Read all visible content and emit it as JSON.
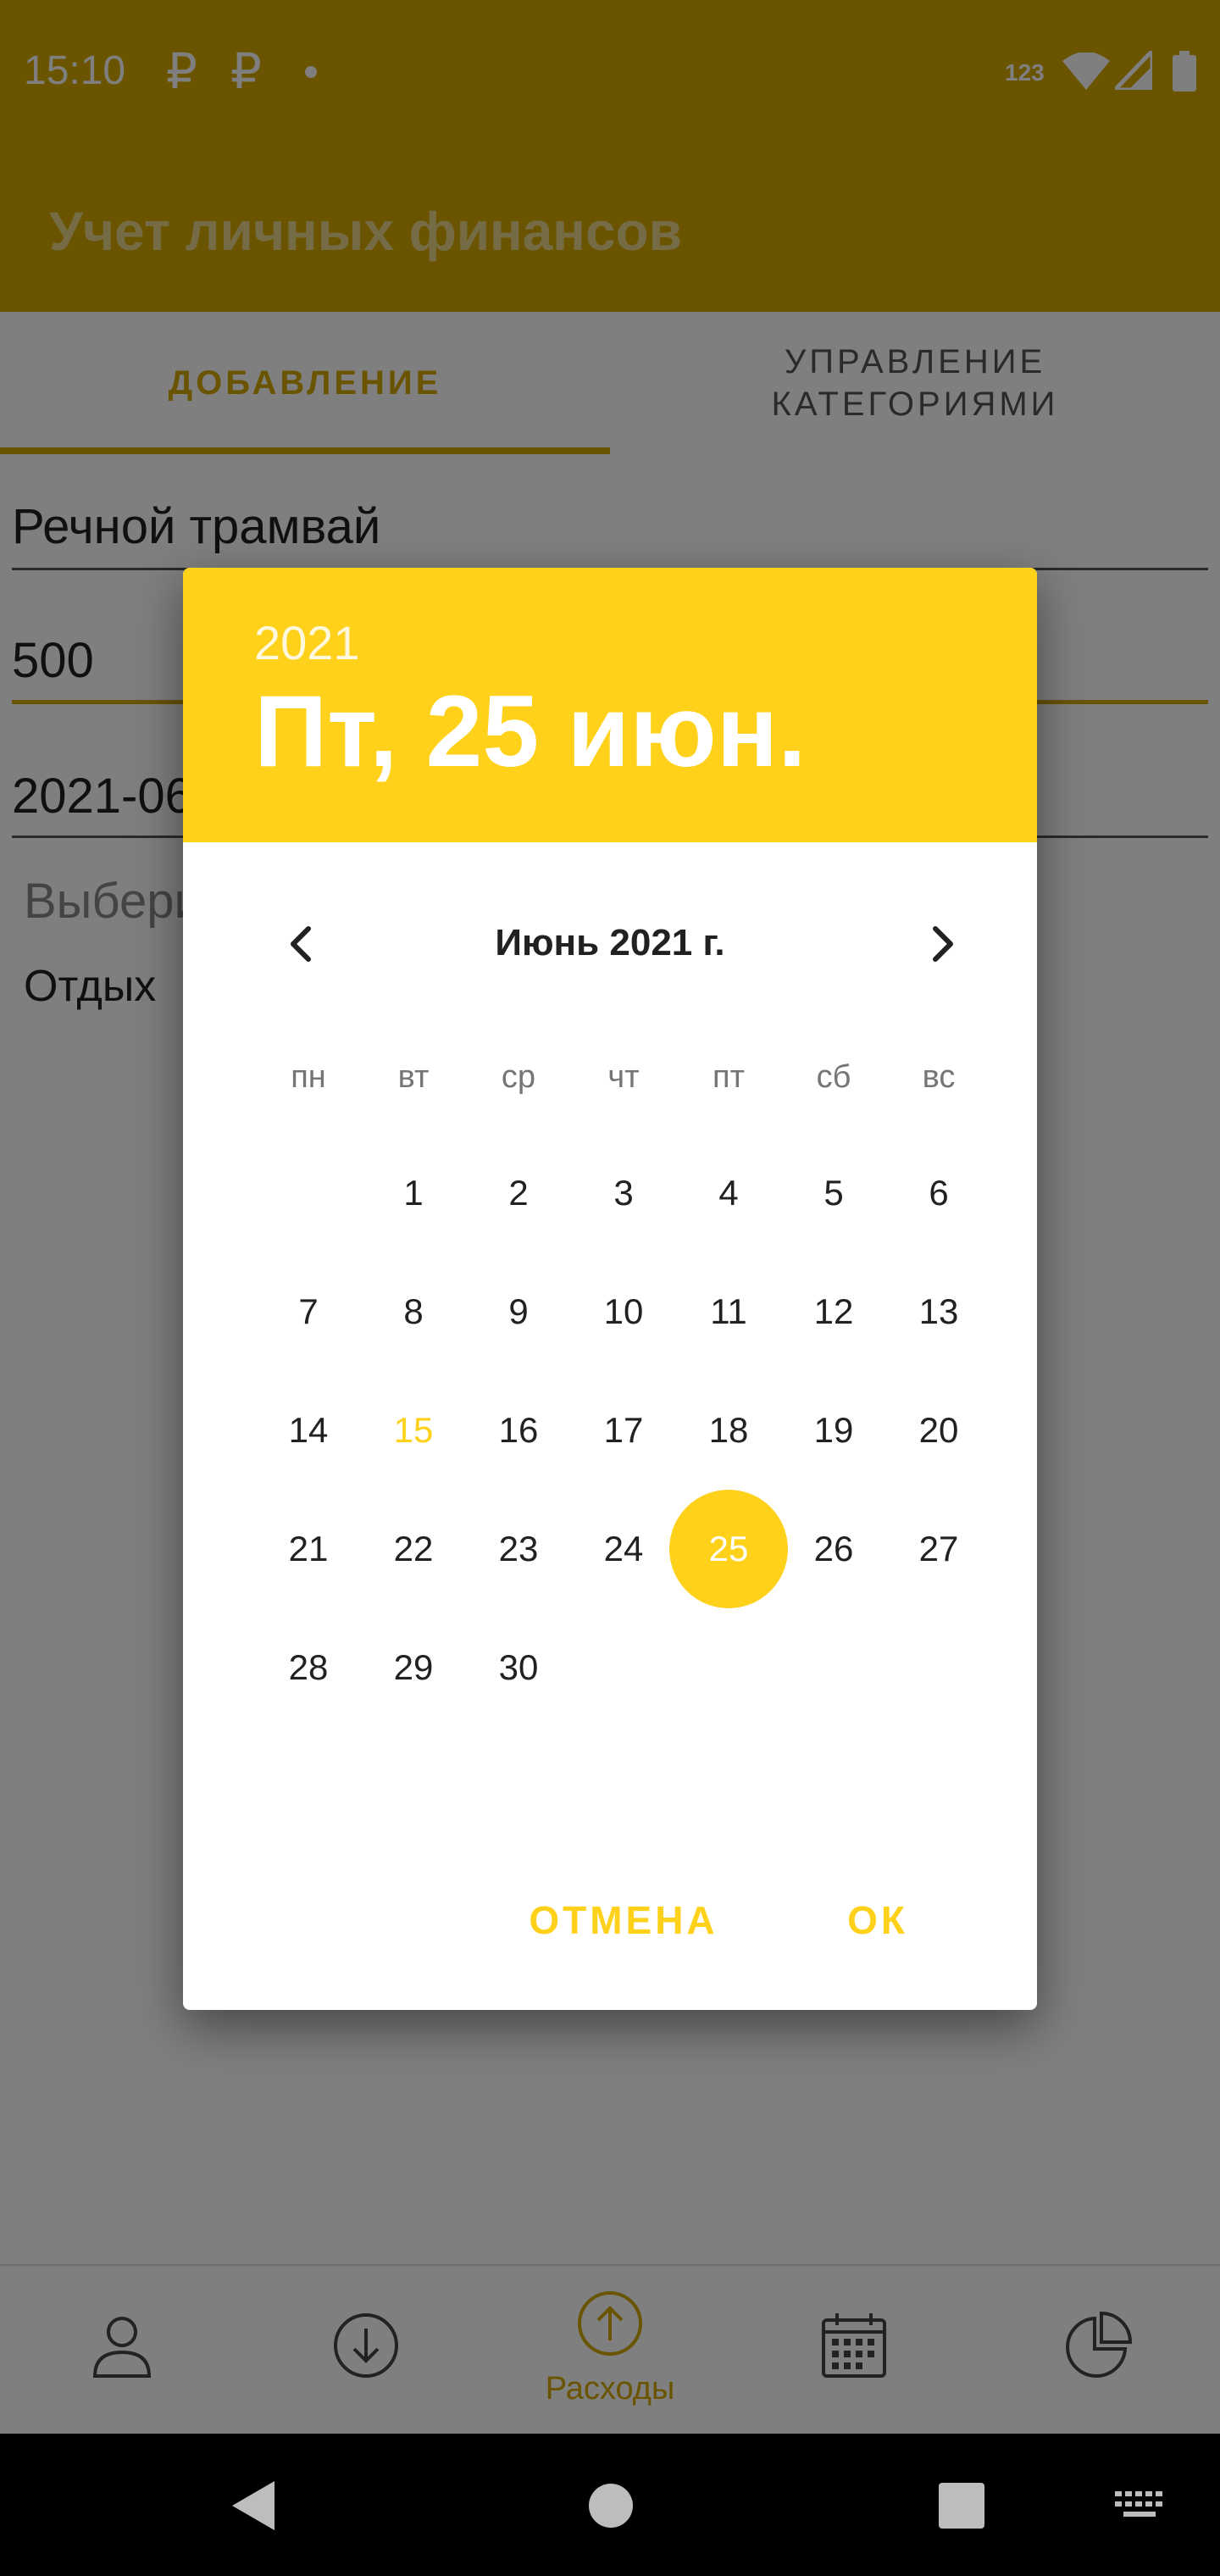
{
  "status_bar": {
    "time": "15:10",
    "glyph_1": "₽",
    "glyph_2": "₽",
    "network_label": "123"
  },
  "app_bar": {
    "title": "Учет личных финансов"
  },
  "tabs": [
    {
      "label": "ДОБАВЛЕНИЕ"
    },
    {
      "label": "УПРАВЛЕНИЕ\nКАТЕГОРИЯМИ"
    }
  ],
  "form": {
    "name_value": "Речной трамвай",
    "amount_value": "500",
    "date_value": "2021-06-25",
    "category_hint": "Выберите категорию",
    "category_value": "Отдых"
  },
  "dialog": {
    "header_year": "2021",
    "header_date": "Пт, 25 июн.",
    "month_label": "Июнь 2021 г.",
    "weekdays": [
      "пн",
      "вт",
      "ср",
      "чт",
      "пт",
      "сб",
      "вс"
    ],
    "first_weekday_offset": 1,
    "days_in_month": 30,
    "today_day": 15,
    "selected_day": 25,
    "cancel_label": "ОТМЕНА",
    "ok_label": "ОК"
  },
  "bottom_nav": {
    "items": [
      {
        "icon": "person-icon"
      },
      {
        "icon": "arrow-down-circle-icon"
      },
      {
        "icon": "arrow-up-circle-icon",
        "label": "Расходы",
        "active": true
      },
      {
        "icon": "calendar-icon"
      },
      {
        "icon": "pie-chart-icon"
      }
    ]
  },
  "colors": {
    "primary": "#d4a900",
    "accent": "#ffd11a"
  }
}
